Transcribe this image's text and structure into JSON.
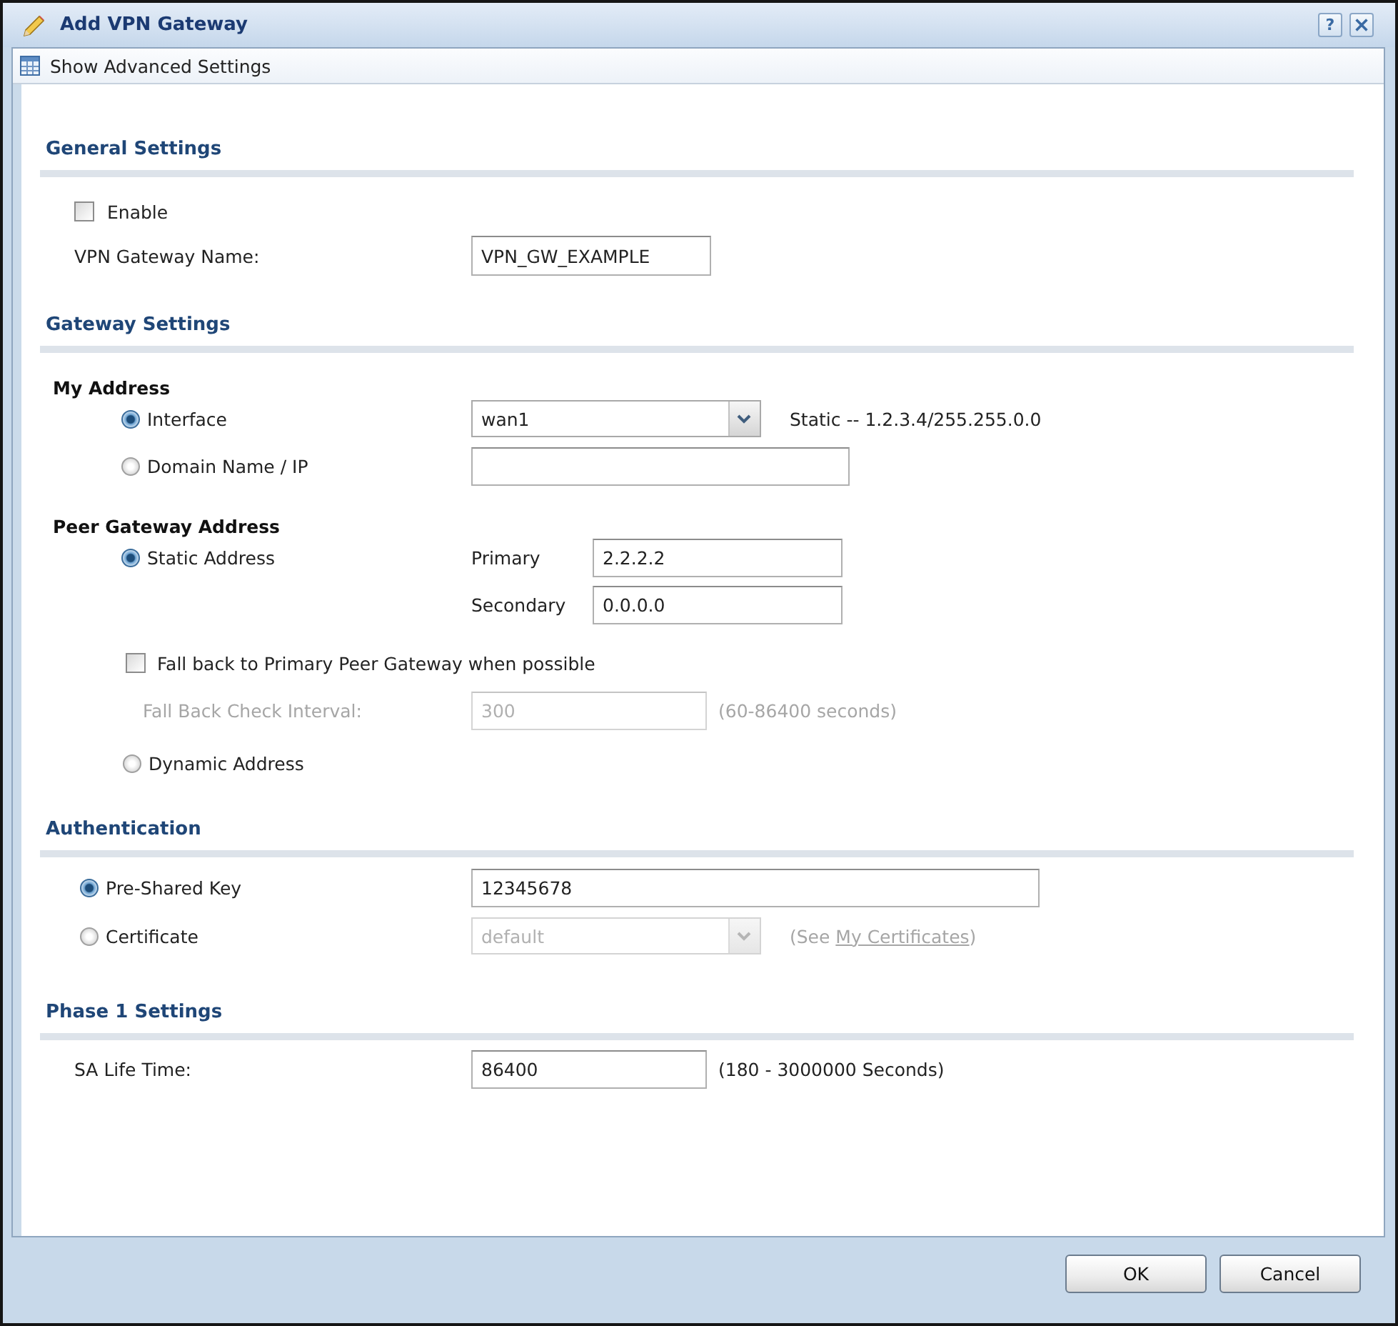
{
  "window": {
    "title": "Add VPN Gateway",
    "help_button": "?"
  },
  "toolbar": {
    "label": "Show Advanced Settings"
  },
  "general_settings": {
    "title": "General Settings",
    "enable": {
      "label": "Enable",
      "checked": false
    },
    "gateway_name": {
      "label": "VPN Gateway Name:",
      "value": "VPN_GW_EXAMPLE"
    }
  },
  "gateway_settings": {
    "title": "Gateway Settings",
    "my_address": {
      "title": "My Address",
      "options": [
        {
          "kind": "select",
          "label": "Interface",
          "selected": true,
          "value": "wan1",
          "note": "Static -- 1.2.3.4/255.255.0.0"
        },
        {
          "kind": "input",
          "label": "Domain Name / IP",
          "selected": false
        }
      ]
    },
    "peer_gateway_address": {
      "title": "Peer Gateway Address",
      "options": [
        {
          "kind": "static",
          "label": "Static Address",
          "selected": true,
          "fields": [
            {
              "label": "Primary",
              "value": "2.2.2.2"
            },
            {
              "label": "Secondary",
              "value": "0.0.0.0"
            }
          ],
          "fall_back": {
            "label": "Fall back to Primary Peer Gateway when possible",
            "checked": false
          },
          "check_interval": {
            "label": "Fall Back Check Interval:",
            "value": "300",
            "hint": "(60-86400 seconds)",
            "disabled": true
          }
        },
        {
          "kind": "dynamic",
          "label": "Dynamic Address",
          "selected": false
        }
      ]
    }
  },
  "authentication": {
    "title": "Authentication",
    "options": [
      {
        "kind": "input",
        "label": "Pre-Shared Key",
        "selected": true,
        "value": "12345678"
      },
      {
        "kind": "select",
        "label": "Certificate",
        "selected": false,
        "disabled": true,
        "value": "default",
        "note_before": "(See ",
        "link": "My Certificates",
        "note_after": ")"
      }
    ]
  },
  "phase1_settings": {
    "title": "Phase 1 Settings",
    "sa_life_time": {
      "label": "SA Life Time:",
      "value": "86400",
      "hint": "(180 - 3000000 Seconds)"
    }
  },
  "buttons": [
    {
      "label": "OK"
    },
    {
      "label": "Cancel"
    }
  ]
}
